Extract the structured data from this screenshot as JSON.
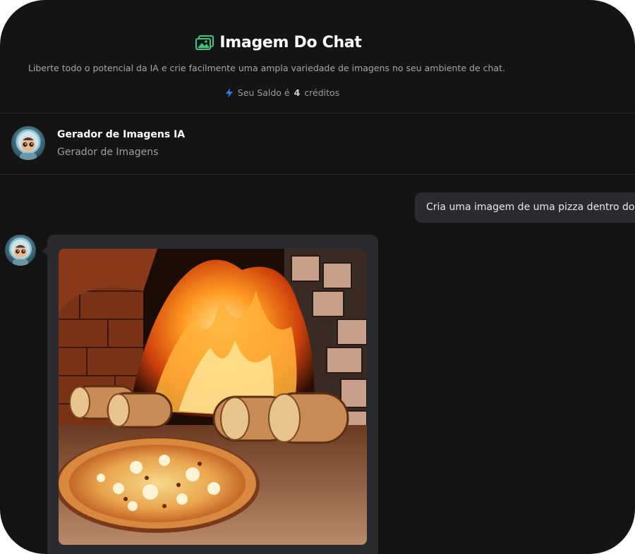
{
  "header": {
    "title": "Imagem Do Chat",
    "title_icon": "gallery-icon",
    "subtitle": "Liberte todo o potencial da IA e crie facilmente uma ampla variedade de imagens no seu ambiente de chat.",
    "balance": {
      "icon": "lightning-bolt-icon",
      "prefix": "Seu Saldo é",
      "amount": "4",
      "suffix": "créditos"
    }
  },
  "bot": {
    "name": "Gerador de Imagens IA",
    "role": "Gerador de Imagens",
    "avatar": "robot-avatar"
  },
  "messages": [
    {
      "from": "user",
      "text": "Cria uma imagem de uma pizza dentro do"
    },
    {
      "from": "bot",
      "type": "image",
      "image_subject": "pizza in front of a wood-fired brick oven"
    }
  ],
  "colors": {
    "background": "#141414",
    "accent_green": "#3ec67f",
    "bolt_blue": "#2f7de1",
    "bubble": "#2a2b2f",
    "divider": "#2a2a2a"
  }
}
